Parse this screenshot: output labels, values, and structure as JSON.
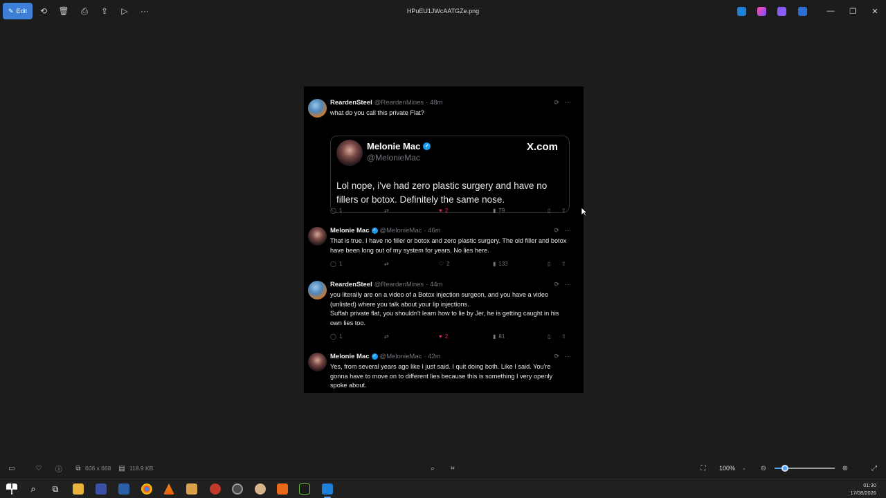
{
  "toolbar": {
    "edit_label": "Edit",
    "file_title": "HPuEU1JWcAATGZe.png",
    "more_label": "···"
  },
  "tweets": [
    {
      "name": "ReardenSteel",
      "handle": "@ReardenMines",
      "time": "· 48m",
      "verified": false,
      "text": "what do you call this private Flat?",
      "replies": "1",
      "retweets": "",
      "likes": "2",
      "liked": true,
      "views": "79"
    },
    {
      "name": "Melonie Mac",
      "handle": "@MelonieMac",
      "time": "· 46m",
      "verified": true,
      "text": "That is true. I have no filler or botox and zero plastic surgery. The old filler and botox have been long out of my system for years. No lies here.",
      "replies": "1",
      "retweets": "",
      "likes": "2",
      "liked": false,
      "views": "133"
    },
    {
      "name": "ReardenSteel",
      "handle": "@ReardenMines",
      "time": "· 44m",
      "verified": false,
      "text_lines": [
        "you literally are on a video of a Botox injection surgeon, and you have a video (unlisted) where you talk about your lip injections.",
        "Suffah private flat, you shouldn't learn how to lie by Jer, he is getting caught in his own lies too."
      ],
      "replies": "1",
      "retweets": "",
      "likes": "2",
      "liked": true,
      "views": "81"
    },
    {
      "name": "Melonie Mac",
      "handle": "@MelonieMac",
      "time": "· 42m",
      "verified": true,
      "text": "Yes, from several years ago like I just said. I quit doing both. Like I said. You're gonna have to move on to different lies because this is something I very openly spoke about."
    }
  ],
  "quote": {
    "name": "Melonie Mac",
    "handle": "@MelonieMac",
    "brand": "X.com",
    "text": "Lol nope, i've had zero plastic surgery and have no fillers or botox. Definitely the same nose."
  },
  "status": {
    "dimensions": "606 x 668",
    "file_size": "118.9 KB",
    "zoom": "100%",
    "zoom_fraction": 0.15
  },
  "clock": {
    "time": "01:30",
    "date": "17/08/2026"
  },
  "icons": {
    "reply": "speech-bubble",
    "retweet": "repeat-arrows",
    "like": "heart",
    "views": "bar-chart",
    "bookmark": "bookmark",
    "share": "share-up-arrow"
  },
  "colors": {
    "accent": "#3d7fd6",
    "like_pink": "#f91880",
    "verified_blue": "#1d9bf0"
  }
}
